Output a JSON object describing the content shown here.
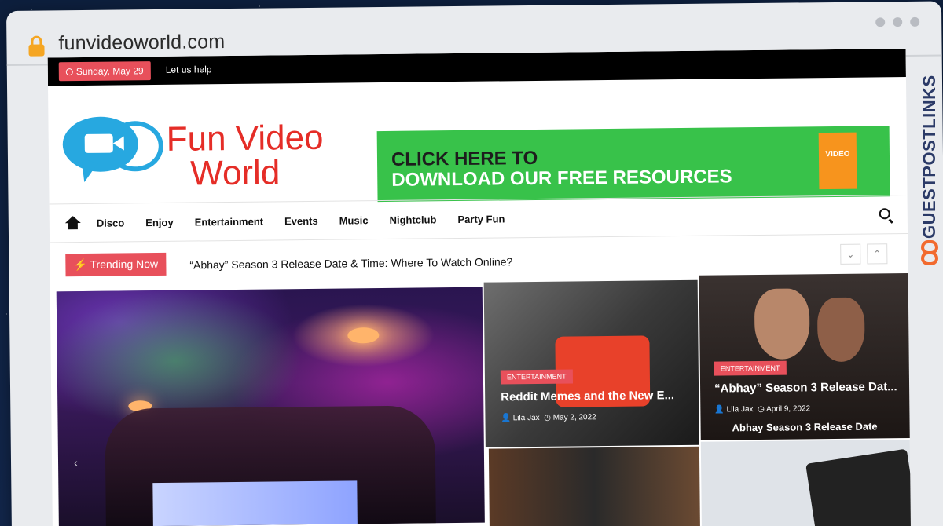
{
  "browser": {
    "url": "funvideoworld.com"
  },
  "topbar": {
    "date": "Sunday, May 29",
    "help_link": "Let us help"
  },
  "header": {
    "logo_line1": "Fun Video",
    "logo_line2": "World",
    "banner_line1": "CLICK HERE TO",
    "banner_line2": "DOWNLOAD OUR FREE RESOURCES",
    "banner_book": "VIDEO"
  },
  "nav": {
    "items": [
      "Disco",
      "Enjoy",
      "Entertainment",
      "Events",
      "Music",
      "Nightclub",
      "Party Fun"
    ]
  },
  "trending": {
    "label": "Trending Now",
    "headline": "“Abhay” Season 3 Release Date & Time: Where To Watch Online?"
  },
  "cards": [
    {
      "category": "ENTERTAINMENT",
      "title": "Reddit Memes and the New E...",
      "author": "Lila Jax",
      "date": "May 2, 2022"
    },
    {
      "category": "ENTERTAINMENT",
      "title": "“Abhay” Season 3 Release Dat...",
      "author": "Lila Jax",
      "date": "April 9, 2022",
      "image_caption": "Abhay Season 3 Release Date"
    }
  ],
  "side_brand": "GUESTPOSTLINKS",
  "colors": {
    "accent": "#e8505b",
    "brand_red": "#e52d27",
    "logo_blue": "#27a8e0",
    "banner_green": "#38c24a",
    "side_brand_orange": "#f26a2e"
  }
}
